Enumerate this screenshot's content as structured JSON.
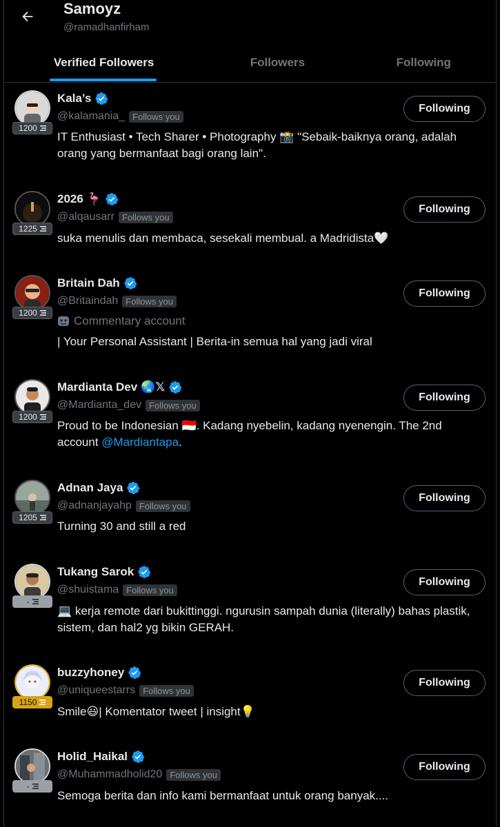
{
  "header": {
    "title": "Samoyz",
    "handle": "@ramadhanfirham"
  },
  "tabs": [
    {
      "label": "Verified Followers",
      "active": true
    },
    {
      "label": "Followers",
      "active": false
    },
    {
      "label": "Following",
      "active": false
    }
  ],
  "colors": {
    "accent": "#1d9bf0",
    "background": "#000000",
    "gold_badge": "#d6a516"
  },
  "users": [
    {
      "name": "Kala’s",
      "name_emoji": "",
      "handle": "@kalamania_",
      "follows_you": "Follows you",
      "level": "1200",
      "button": "Following",
      "sub": "",
      "bio": "IT Enthusiast • Tech Sharer • Photography 📸 \"Sebaik-baiknya orang, adalah orang yang bermanfaat bagi orang lain\"."
    },
    {
      "name": "2026",
      "name_emoji": "🦩",
      "handle": "@alqausarr",
      "follows_you": "Follows you",
      "level": "1225",
      "button": "Following",
      "sub": "",
      "bio": "suka menulis dan membaca, sesekali membual. a Madridista🤍"
    },
    {
      "name": "Britain Dah",
      "name_emoji": "",
      "handle": "@Britaindah",
      "follows_you": "Follows you",
      "level": "1200",
      "button": "Following",
      "sub": "Commentary account",
      "bio": "| Your Personal Assistant | Berita-in semua hal yang jadi viral"
    },
    {
      "name": "Mardianta Dev",
      "name_emoji": "🌏𝕏",
      "handle": "@Mardianta_dev",
      "follows_you": "Follows you",
      "level": "1200",
      "button": "Following",
      "sub": "",
      "bio_pre": "Proud to be Indonesian 🇮🇩. Kadang nyebelin, kadang nyenengin. The 2nd account ",
      "bio_mention": "@Mardiantapa",
      "bio_post": "."
    },
    {
      "name": "Adnan Jaya",
      "name_emoji": "",
      "handle": "@adnanjayahp",
      "follows_you": "Follows you",
      "level": "1205",
      "button": "Following",
      "sub": "",
      "bio": "Turning 30 and still a red"
    },
    {
      "name": "Tukang Sarok",
      "name_emoji": "",
      "handle": "@shuistama",
      "follows_you": "Follows you",
      "level": "-",
      "button": "Following",
      "sub": "",
      "bio": "💻 kerja remote dari bukittinggi. ngurusin sampah dunia (literally) bahas plastik, sistem, dan hal2 yg bikin GERAH."
    },
    {
      "name": "buzzyhoney",
      "name_emoji": "",
      "handle": "@uniqueestarrs",
      "follows_you": "Follows you",
      "level": "1150",
      "button": "Following",
      "sub": "",
      "bio": "Smile😃| Komentator tweet | insight💡"
    },
    {
      "name": "Holid_Haikal",
      "name_emoji": "",
      "handle": "@Muhammadholid20",
      "follows_you": "Follows you",
      "level": "-",
      "button": "Following",
      "sub": "",
      "bio": "Semoga berita dan info kami bermanfaat untuk orang banyak...."
    }
  ]
}
